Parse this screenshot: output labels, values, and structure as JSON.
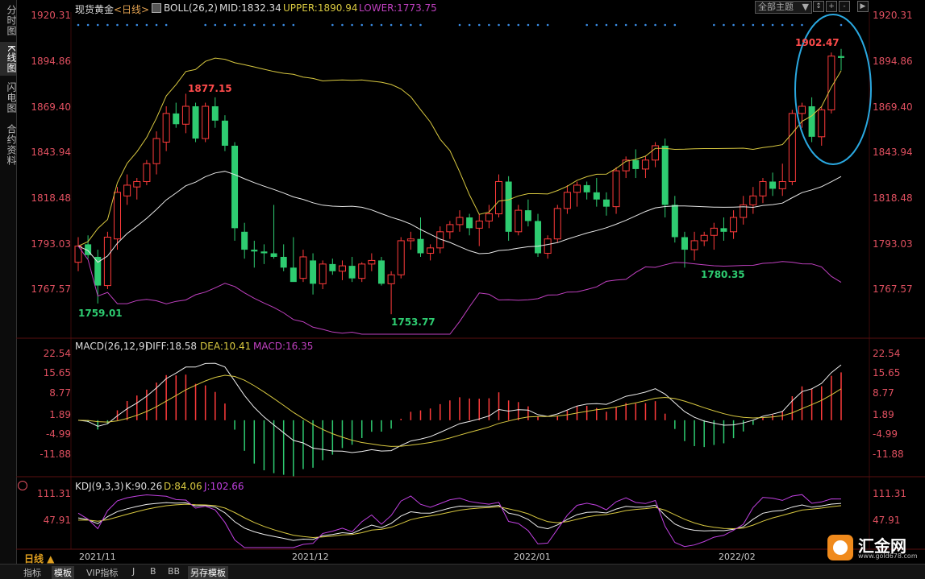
{
  "sidebar": {
    "tabs": [
      {
        "label": "分时图",
        "active": false
      },
      {
        "label": "K线图",
        "active": true
      },
      {
        "label": "闪电图",
        "active": false
      },
      {
        "label": "合约资料",
        "active": false
      }
    ]
  },
  "header": {
    "instrument": "现货黄金",
    "period": "<日线>",
    "boll": "BOLL(26,2)",
    "mid": "MID:1832.34",
    "upper": "UPPER:1890.94",
    "lower": "LOWER:1773.75",
    "theme_dropdown": "全部主题",
    "buttons": [
      "↕",
      "+",
      "-",
      "▶"
    ]
  },
  "price_axis": [
    "1920.31",
    "1894.86",
    "1869.40",
    "1843.94",
    "1818.48",
    "1793.03",
    "1767.57"
  ],
  "price_annotations": {
    "high1": "1877.15",
    "low1": "1759.01",
    "low2": "1753.77",
    "low3": "1780.35",
    "high2": "1902.47"
  },
  "macd": {
    "title": "MACD(26,12,9)",
    "diff": "DIFF:18.58",
    "dea": "DEA:10.41",
    "macd": "MACD:16.35",
    "axis": [
      "22.54",
      "15.65",
      "8.77",
      "1.89",
      "-4.99",
      "-11.88"
    ]
  },
  "kdj": {
    "title": "KDJ(9,3,3)",
    "k": "K:90.26",
    "d": "D:84.06",
    "j": "J:102.66",
    "axis": [
      "111.31",
      "47.91"
    ]
  },
  "dates": [
    "2021/11",
    "2021/12",
    "2022/01",
    "2022/02"
  ],
  "period_button": "日线 ▲",
  "bottom_tabs": [
    "指标",
    "模板",
    "VIP指标",
    "J",
    "B",
    "BB",
    "另存模板"
  ],
  "logo": {
    "name": "汇金网",
    "url": "www.gold678.com"
  },
  "colors": {
    "up": "#ff3b3b",
    "down": "#2ecc71",
    "mid": "#e8e8e8",
    "upper": "#e0d040",
    "lower": "#c040c0",
    "circle": "#2aa8e0"
  },
  "chart_data": {
    "type": "candlestick",
    "title": "现货黄金 <日线>",
    "ylim": [
      1755,
      1925
    ],
    "candles": [
      {
        "o": 1783,
        "h": 1797,
        "l": 1778,
        "c": 1792
      },
      {
        "o": 1793,
        "h": 1798,
        "l": 1785,
        "c": 1787
      },
      {
        "o": 1786,
        "h": 1790,
        "l": 1760,
        "c": 1770
      },
      {
        "o": 1770,
        "h": 1800,
        "l": 1768,
        "c": 1797
      },
      {
        "o": 1796,
        "h": 1825,
        "l": 1790,
        "c": 1822
      },
      {
        "o": 1820,
        "h": 1832,
        "l": 1815,
        "c": 1826
      },
      {
        "o": 1825,
        "h": 1830,
        "l": 1818,
        "c": 1828
      },
      {
        "o": 1828,
        "h": 1840,
        "l": 1826,
        "c": 1838
      },
      {
        "o": 1838,
        "h": 1856,
        "l": 1832,
        "c": 1852
      },
      {
        "o": 1850,
        "h": 1870,
        "l": 1845,
        "c": 1866
      },
      {
        "o": 1866,
        "h": 1872,
        "l": 1858,
        "c": 1860
      },
      {
        "o": 1860,
        "h": 1877,
        "l": 1855,
        "c": 1870
      },
      {
        "o": 1870,
        "h": 1872,
        "l": 1850,
        "c": 1852
      },
      {
        "o": 1852,
        "h": 1872,
        "l": 1850,
        "c": 1870
      },
      {
        "o": 1870,
        "h": 1875,
        "l": 1858,
        "c": 1862
      },
      {
        "o": 1862,
        "h": 1865,
        "l": 1845,
        "c": 1848
      },
      {
        "o": 1848,
        "h": 1850,
        "l": 1795,
        "c": 1802
      },
      {
        "o": 1800,
        "h": 1805,
        "l": 1785,
        "c": 1790
      },
      {
        "o": 1790,
        "h": 1795,
        "l": 1780,
        "c": 1789
      },
      {
        "o": 1789,
        "h": 1793,
        "l": 1782,
        "c": 1788
      },
      {
        "o": 1788,
        "h": 1815,
        "l": 1785,
        "c": 1786
      },
      {
        "o": 1786,
        "h": 1793,
        "l": 1778,
        "c": 1780
      },
      {
        "o": 1780,
        "h": 1797,
        "l": 1775,
        "c": 1772
      },
      {
        "o": 1774,
        "h": 1790,
        "l": 1772,
        "c": 1786
      },
      {
        "o": 1784,
        "h": 1788,
        "l": 1765,
        "c": 1771
      },
      {
        "o": 1771,
        "h": 1784,
        "l": 1768,
        "c": 1782
      },
      {
        "o": 1782,
        "h": 1785,
        "l": 1776,
        "c": 1778
      },
      {
        "o": 1778,
        "h": 1784,
        "l": 1773,
        "c": 1781
      },
      {
        "o": 1781,
        "h": 1786,
        "l": 1772,
        "c": 1774
      },
      {
        "o": 1774,
        "h": 1783,
        "l": 1772,
        "c": 1782
      },
      {
        "o": 1782,
        "h": 1788,
        "l": 1778,
        "c": 1784
      },
      {
        "o": 1784,
        "h": 1786,
        "l": 1770,
        "c": 1771
      },
      {
        "o": 1771,
        "h": 1778,
        "l": 1754,
        "c": 1776
      },
      {
        "o": 1776,
        "h": 1797,
        "l": 1774,
        "c": 1795
      },
      {
        "o": 1795,
        "h": 1800,
        "l": 1790,
        "c": 1796
      },
      {
        "o": 1796,
        "h": 1808,
        "l": 1786,
        "c": 1788
      },
      {
        "o": 1788,
        "h": 1793,
        "l": 1784,
        "c": 1791
      },
      {
        "o": 1791,
        "h": 1803,
        "l": 1788,
        "c": 1800
      },
      {
        "o": 1800,
        "h": 1806,
        "l": 1796,
        "c": 1804
      },
      {
        "o": 1804,
        "h": 1812,
        "l": 1800,
        "c": 1808
      },
      {
        "o": 1808,
        "h": 1810,
        "l": 1798,
        "c": 1802
      },
      {
        "o": 1802,
        "h": 1810,
        "l": 1792,
        "c": 1806
      },
      {
        "o": 1806,
        "h": 1815,
        "l": 1802,
        "c": 1810
      },
      {
        "o": 1810,
        "h": 1832,
        "l": 1808,
        "c": 1828
      },
      {
        "o": 1828,
        "h": 1831,
        "l": 1795,
        "c": 1800
      },
      {
        "o": 1800,
        "h": 1815,
        "l": 1798,
        "c": 1812
      },
      {
        "o": 1812,
        "h": 1818,
        "l": 1803,
        "c": 1806
      },
      {
        "o": 1806,
        "h": 1810,
        "l": 1786,
        "c": 1788
      },
      {
        "o": 1788,
        "h": 1798,
        "l": 1785,
        "c": 1796
      },
      {
        "o": 1796,
        "h": 1815,
        "l": 1794,
        "c": 1813
      },
      {
        "o": 1813,
        "h": 1826,
        "l": 1810,
        "c": 1822
      },
      {
        "o": 1822,
        "h": 1828,
        "l": 1814,
        "c": 1826
      },
      {
        "o": 1826,
        "h": 1828,
        "l": 1818,
        "c": 1822
      },
      {
        "o": 1822,
        "h": 1830,
        "l": 1814,
        "c": 1818
      },
      {
        "o": 1818,
        "h": 1822,
        "l": 1809,
        "c": 1814
      },
      {
        "o": 1814,
        "h": 1836,
        "l": 1810,
        "c": 1834
      },
      {
        "o": 1834,
        "h": 1842,
        "l": 1830,
        "c": 1840
      },
      {
        "o": 1840,
        "h": 1846,
        "l": 1830,
        "c": 1835
      },
      {
        "o": 1835,
        "h": 1842,
        "l": 1830,
        "c": 1840
      },
      {
        "o": 1840,
        "h": 1850,
        "l": 1836,
        "c": 1848
      },
      {
        "o": 1848,
        "h": 1852,
        "l": 1808,
        "c": 1815
      },
      {
        "o": 1815,
        "h": 1820,
        "l": 1794,
        "c": 1797
      },
      {
        "o": 1797,
        "h": 1800,
        "l": 1780,
        "c": 1790
      },
      {
        "o": 1790,
        "h": 1800,
        "l": 1784,
        "c": 1795
      },
      {
        "o": 1795,
        "h": 1800,
        "l": 1792,
        "c": 1798
      },
      {
        "o": 1798,
        "h": 1805,
        "l": 1790,
        "c": 1802
      },
      {
        "o": 1802,
        "h": 1808,
        "l": 1795,
        "c": 1800
      },
      {
        "o": 1800,
        "h": 1812,
        "l": 1796,
        "c": 1808
      },
      {
        "o": 1808,
        "h": 1820,
        "l": 1804,
        "c": 1815
      },
      {
        "o": 1815,
        "h": 1825,
        "l": 1810,
        "c": 1820
      },
      {
        "o": 1820,
        "h": 1830,
        "l": 1816,
        "c": 1828
      },
      {
        "o": 1828,
        "h": 1833,
        "l": 1820,
        "c": 1824
      },
      {
        "o": 1824,
        "h": 1838,
        "l": 1820,
        "c": 1828
      },
      {
        "o": 1828,
        "h": 1868,
        "l": 1826,
        "c": 1866
      },
      {
        "o": 1866,
        "h": 1872,
        "l": 1858,
        "c": 1870
      },
      {
        "o": 1870,
        "h": 1875,
        "l": 1850,
        "c": 1853
      },
      {
        "o": 1853,
        "h": 1870,
        "l": 1848,
        "c": 1868
      },
      {
        "o": 1868,
        "h": 1900,
        "l": 1866,
        "c": 1898
      },
      {
        "o": 1898,
        "h": 1902,
        "l": 1890,
        "c": 1897
      }
    ]
  }
}
